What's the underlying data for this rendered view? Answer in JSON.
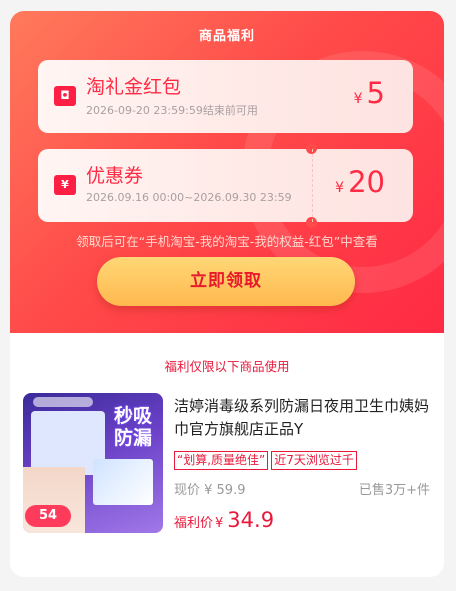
{
  "header": {
    "title": "商品福利"
  },
  "coupons": [
    {
      "name": "淘礼金红包",
      "subtitle": "2026-09-20 23:59:59结束前可用",
      "currency": "¥",
      "amount": "5",
      "icon": "red-envelope-icon"
    },
    {
      "name": "优惠券",
      "subtitle": "2026.09.16 00:00~2026.09.30 23:59",
      "currency": "¥",
      "amount": "20",
      "icon": "coupon-ticket-icon"
    }
  ],
  "note": "领取后可在“手机淘宝-我的淘宝-我的权益-红包”中查看",
  "claim_button": "立即领取",
  "section_title": "福利仅限以下商品使用",
  "product": {
    "title": "洁婷消毒级系列防漏日夜用卫生巾姨妈巾官方旗舰店正品Y",
    "tags": [
      "“划算,质量绝佳”",
      "近7天浏览过千"
    ],
    "original_price": "现价 ¥ 59.9",
    "sold": "已售3万+件",
    "welfare_label": "福利价",
    "welfare_currency": "¥",
    "welfare_price": "34.9",
    "image_text": "秒吸防漏",
    "image_badge": "54",
    "image_icon": "product-thumbnail"
  },
  "colors": {
    "accent": "#ff2a44",
    "button": "#ffc85e"
  }
}
